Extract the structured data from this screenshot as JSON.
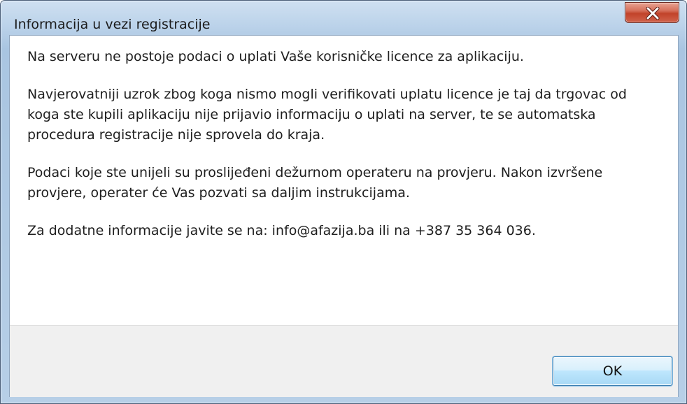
{
  "window": {
    "title": "Informacija u vezi registracije"
  },
  "titlebar": {
    "close_icon": "close-x-icon"
  },
  "message": {
    "paragraphs": [
      "Na serveru ne postoje podaci o uplati Vaše korisničke licence za aplikaciju.",
      "Navjerovatniji uzrok zbog koga nismo mogli verifikovati uplatu licence je taj da trgovac od koga ste kupili aplikaciju nije prijavio informaciju o uplati na server, te se automatska procedura registracije nije sprovela do kraja.",
      "Podaci koje ste unijeli su proslijeđeni dežurnom operateru na provjeru. Nakon izvršene provjere, operater će Vas pozvati sa daljim instrukcijama.",
      "Za dodatne informacije javite se na: info@afazija.ba ili na +387 35 364 036."
    ]
  },
  "footer": {
    "ok_label": "OK"
  }
}
